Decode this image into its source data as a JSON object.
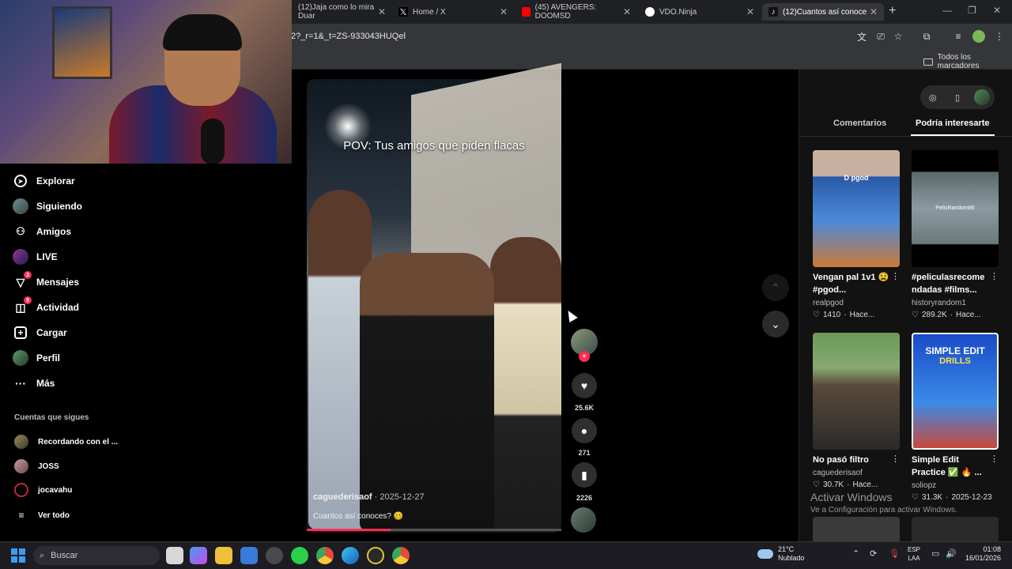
{
  "browser": {
    "tabs": [
      {
        "label": "(12)Jaja como lo mira Duar",
        "icon_color": "#1f2023"
      },
      {
        "label": "Home / X",
        "icon_color": "#000000"
      },
      {
        "label": "(45) AVENGERS: DOOMSD",
        "icon_color": "#ff0000"
      },
      {
        "label": "VDO.Ninja",
        "icon_color": "#ffffff"
      },
      {
        "label": "(12)Cuantos así conoce",
        "icon_color": "#111111"
      }
    ],
    "new_tab": "+",
    "url": "2?_r=1&_t=ZS-933043HUQel",
    "bookmarks_label": "Todos los marcadores"
  },
  "sidebar": {
    "items": [
      {
        "label": "Explorar",
        "icon": "compass-icon",
        "glyph": "◎"
      },
      {
        "label": "Siguiendo",
        "icon": "following-avatar-icon",
        "glyph": ""
      },
      {
        "label": "Amigos",
        "icon": "friends-icon",
        "glyph": "👥"
      },
      {
        "label": "LIVE",
        "icon": "live-icon",
        "glyph": ""
      },
      {
        "label": "Mensajes",
        "icon": "messages-icon",
        "glyph": "▽",
        "badge": "3"
      },
      {
        "label": "Actividad",
        "icon": "activity-icon",
        "glyph": "◉",
        "badge": "9"
      },
      {
        "label": "Cargar",
        "icon": "upload-icon",
        "glyph": "⊞"
      },
      {
        "label": "Perfil",
        "icon": "profile-avatar-icon",
        "glyph": ""
      },
      {
        "label": "Más",
        "icon": "more-icon",
        "glyph": "···"
      }
    ],
    "following_title": "Cuentas que sigues",
    "following": [
      {
        "name": "Recordando con el ..."
      },
      {
        "name": "JOSS"
      },
      {
        "name": "jocavahu"
      }
    ],
    "see_all": "Ver todo"
  },
  "video": {
    "caption_overlay": "POV: Tus amigos que piden flacas",
    "author": "caguederisaof",
    "date": "2025-12-27",
    "description": "Cuantos así conoces? 🥴",
    "progress": 0.33
  },
  "actions": {
    "likes": "25.6K",
    "comments": "271",
    "saves": "2226",
    "follow_plus": "+"
  },
  "panel": {
    "tabs": [
      "Comentarios",
      "Podría interesarte"
    ],
    "active_tab": "Podría interesarte",
    "cards": [
      {
        "title_line1": "Vengan pal 1v1 😫",
        "title_line2": "#pgod...",
        "user": "realpgod",
        "likes": "1410",
        "time": "Hace...",
        "thumb_text": "D pgod"
      },
      {
        "title_line1": "#peliculasrecome",
        "title_line2": "ndadas #films...",
        "user": "historyrandom1",
        "likes": "289.2K",
        "time": "Hace...",
        "thumb_text": "PelisRandom86"
      },
      {
        "title_line1": "No pasó filtro",
        "title_line2": "",
        "user": "caguederisaof",
        "likes": "30.7K",
        "time": "Hace...",
        "thumb_text": ""
      },
      {
        "title_line1": "Simple Edit",
        "title_line2": "Practice ✅ 🔥 ...",
        "user": "soliopz",
        "likes": "31.3K",
        "time": "2025-12-23",
        "thumb_text": "SIMPLE EDIT"
      }
    ],
    "card4_thumb_sub": "DRILLS"
  },
  "watermark": {
    "line1": "Activar Windows",
    "line2": "Ve a Configuración para activar Windows."
  },
  "taskbar": {
    "search_label": "Buscar",
    "weather_temp": "21°C",
    "weather_desc": "Nublado",
    "lang_line1": "ESP",
    "lang_line2": "LAA",
    "time": "01:08",
    "date": "16/01/2026"
  }
}
